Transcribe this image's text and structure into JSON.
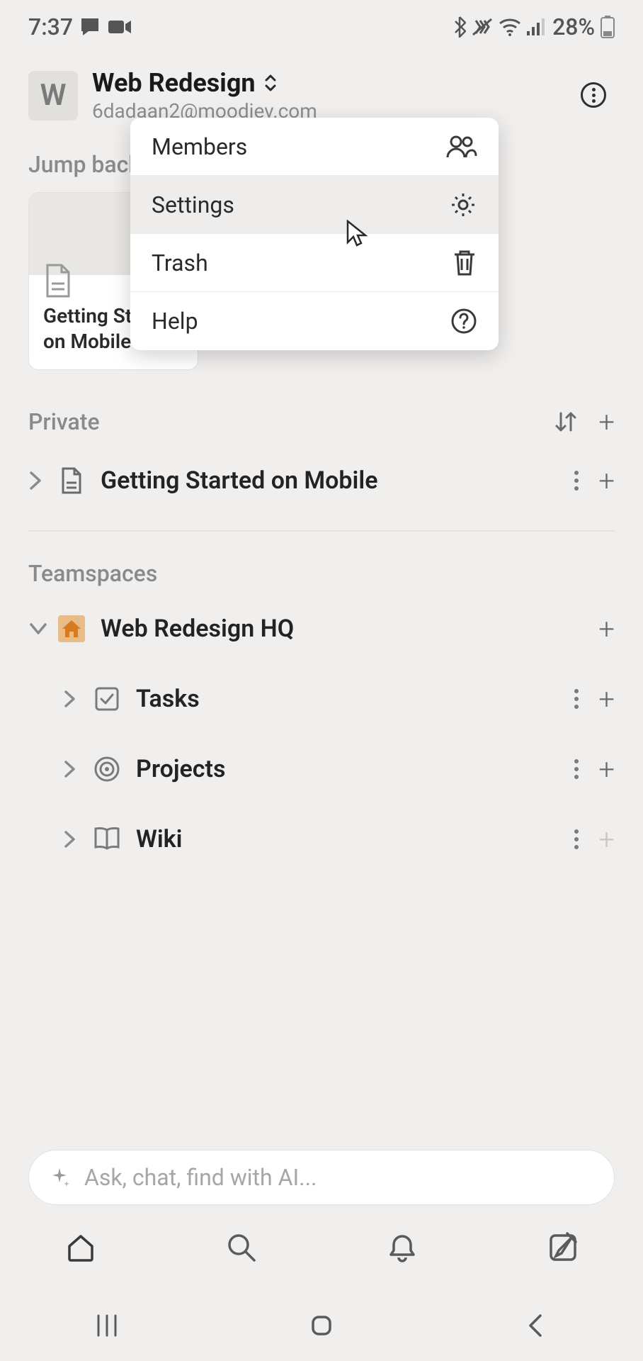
{
  "status": {
    "time": "7:37",
    "battery": "28%"
  },
  "workspace": {
    "badge": "W",
    "name": "Web Redesign",
    "email": "6dadaan2@moodiev.com"
  },
  "dropdown": {
    "members": "Members",
    "settings": "Settings",
    "trash": "Trash",
    "help": "Help"
  },
  "sections": {
    "jumpback": "Jump back in",
    "private": "Private",
    "teamspaces": "Teamspaces"
  },
  "card": {
    "title_l1": "Getting St",
    "title_l2": "on Mobile"
  },
  "private_items": {
    "getting_started": "Getting Started on Mobile"
  },
  "teamspace": {
    "name": "Web Redesign HQ",
    "tasks": "Tasks",
    "projects": "Projects",
    "wiki": "Wiki"
  },
  "ai_placeholder": "Ask, chat, find with AI..."
}
